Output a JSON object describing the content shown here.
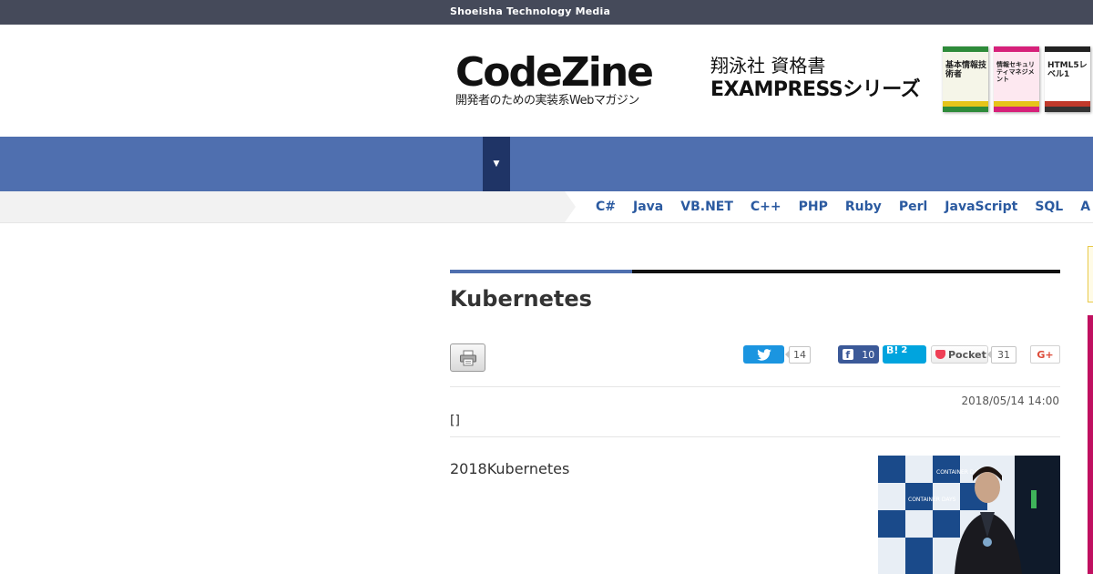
{
  "topbar": {
    "brand": "Shoeisha Technology Media"
  },
  "header": {
    "logo_main": "CodeZine",
    "logo_sub": "開発者のための実装系Webマガジン",
    "ad_line1": "翔泳社 資格書",
    "ad_line2": "EXAMPRESSシリーズ",
    "books": [
      {
        "title": "基本情報技術者"
      },
      {
        "title": "情報セキュリティマネジメント"
      },
      {
        "title": "HTML5レベル1"
      }
    ]
  },
  "nav": {
    "toggle_symbol": "▼"
  },
  "langbar": {
    "languages": [
      "C#",
      "Java",
      "VB.NET",
      "C++",
      "PHP",
      "Ruby",
      "Perl",
      "JavaScript",
      "SQL",
      "A"
    ]
  },
  "article": {
    "title": "Kubernetes",
    "date": "2018/05/14 14:00",
    "category": "[]",
    "lead": "2018Kubernetes",
    "photo_text": "CONTAINER DAYS"
  },
  "share": {
    "twitter_count": "14",
    "facebook_count": "10",
    "hatena_label": "B!",
    "hatena_count": "2",
    "pocket_label": "Pocket",
    "pocket_count": "31",
    "gplus_label": "G+"
  },
  "colors": {
    "topbar": "#454a5a",
    "nav": "#4f6faf",
    "nav_toggle": "#1f3466",
    "link": "#2b5aa0",
    "twitter": "#1b95e0",
    "facebook": "#3b5998",
    "hatena": "#00a4de",
    "pocket": "#ef4056",
    "gplus": "#dd4b39"
  }
}
